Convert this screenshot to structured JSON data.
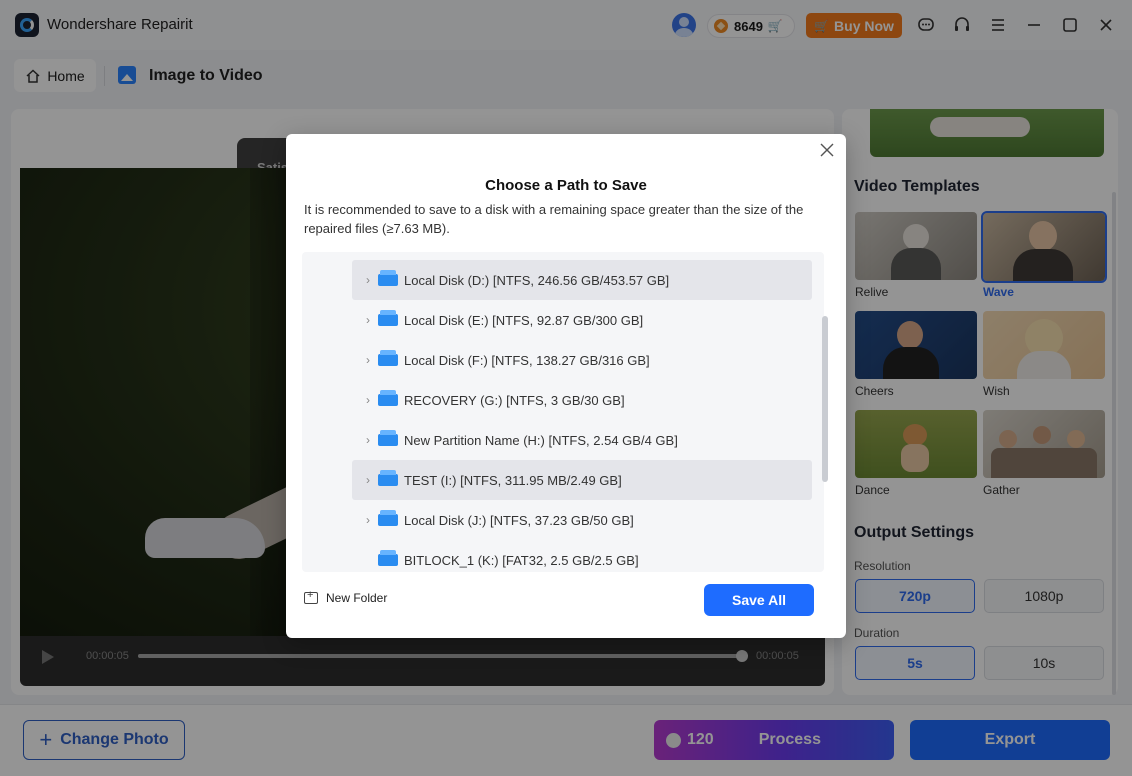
{
  "app": {
    "title": "Wondershare Repairit",
    "credits": "8649",
    "buy_label": "Buy Now"
  },
  "nav": {
    "home_label": "Home",
    "page_title": "Image to Video"
  },
  "preview": {
    "toast_text": "Satis",
    "time_current": "00:00:05",
    "time_total": "00:00:05",
    "progress": 1.0
  },
  "templates": {
    "title": "Video Templates",
    "items": [
      {
        "label": "Relive",
        "selected": false
      },
      {
        "label": "Wave",
        "selected": true
      },
      {
        "label": "Cheers",
        "selected": false
      },
      {
        "label": "Wish",
        "selected": false
      },
      {
        "label": "Dance",
        "selected": false
      },
      {
        "label": "Gather",
        "selected": false
      }
    ]
  },
  "output": {
    "title": "Output Settings",
    "resolution_label": "Resolution",
    "resolution_options": [
      "720p",
      "1080p"
    ],
    "resolution_selected": "720p",
    "duration_label": "Duration",
    "duration_options": [
      "5s",
      "10s"
    ],
    "duration_selected": "5s"
  },
  "bottom": {
    "change_photo": "Change Photo",
    "process_credits": "120",
    "process_label": "Process",
    "export_label": "Export"
  },
  "dialog": {
    "title": "Choose a Path to Save",
    "description": "It is recommended to save to a disk with a remaining space greater than the size of the repaired files (≥7.63 MB).",
    "disks": [
      {
        "label": "Local Disk (D:) [NTFS, 246.56 GB/453.57 GB]",
        "highlighted": true,
        "expandable": true
      },
      {
        "label": "Local Disk (E:) [NTFS, 92.87 GB/300 GB]",
        "highlighted": false,
        "expandable": true
      },
      {
        "label": "Local Disk (F:) [NTFS, 138.27 GB/316 GB]",
        "highlighted": false,
        "expandable": true
      },
      {
        "label": "RECOVERY (G:) [NTFS, 3 GB/30 GB]",
        "highlighted": false,
        "expandable": true
      },
      {
        "label": "New Partition Name (H:) [NTFS, 2.54 GB/4 GB]",
        "highlighted": false,
        "expandable": true
      },
      {
        "label": "TEST (I:) [NTFS, 311.95 MB/2.49 GB]",
        "highlighted": true,
        "expandable": true
      },
      {
        "label": "Local Disk (J:) [NTFS, 37.23 GB/50 GB]",
        "highlighted": false,
        "expandable": true
      },
      {
        "label": "BITLOCK_1 (K:) [FAT32, 2.5 GB/2.5 GB]",
        "highlighted": false,
        "expandable": false
      }
    ],
    "new_folder": "New Folder",
    "save_all": "Save All"
  }
}
